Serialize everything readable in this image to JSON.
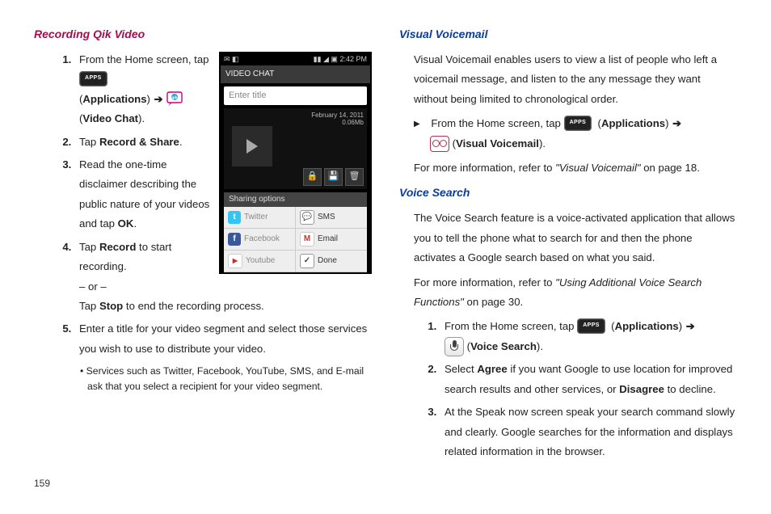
{
  "page_number": "159",
  "left": {
    "heading": "Recording Qik Video",
    "steps": {
      "s1a": "From the Home screen, tap ",
      "s1_apps_paren": "Applications",
      "s1_vc_paren": "Video Chat",
      "s2a": "Tap ",
      "s2b": "Record & Share",
      "s3": "Read the one-time disclaimer describing the public nature of your videos and tap ",
      "s3b": "OK",
      "s4a": "Tap ",
      "s4b": "Record",
      "s4c": " to start recording.",
      "s4or": "– or –",
      "s4d": "Tap ",
      "s4e": "Stop",
      "s4f": " to end the recording process.",
      "s5": "Enter a title for your video segment and select those services you wish to use to distribute your video.",
      "sub": "Services such as Twitter, Facebook, YouTube, SMS, and E-mail ask that you select a recipient for your video segment."
    },
    "phone": {
      "time": "2:42 PM",
      "bar_title": "VIDEO CHAT",
      "input_placeholder": "Enter title",
      "date": "February 14, 2011",
      "size": "0.06Mb",
      "sharing_header": "Sharing options",
      "rows": [
        {
          "l_label": "Twitter",
          "r_label": "SMS"
        },
        {
          "l_label": "Facebook",
          "r_label": "Email"
        },
        {
          "l_label": "Youtube",
          "r_label": "Done"
        }
      ]
    }
  },
  "right": {
    "vv_heading": "Visual Voicemail",
    "vv_p1": "Visual Voicemail enables users to view a list of people who left a voicemail message, and listen to the any message they want without being limited to chronological order.",
    "vv_step_a": "From the Home screen, tap ",
    "vv_apps": "Applications",
    "vv_label": "Visual Voicemail",
    "vv_more_a": "For more information, refer to ",
    "vv_more_ref": "\"Visual Voicemail\"",
    "vv_more_b": " on page 18.",
    "vs_heading": "Voice Search",
    "vs_p1": "The Voice Search feature is a voice-activated application that allows you to tell the phone what to search for and then the phone activates a Google search based on what you said.",
    "vs_more_a": "For more information, refer to ",
    "vs_more_ref": "\"Using Additional Voice Search Functions\"",
    "vs_more_b": " on page 30.",
    "vs_s1a": "From the Home screen, tap ",
    "vs_apps": "Applications",
    "vs_label": "Voice Search",
    "vs_s2a": "Select ",
    "vs_s2b": "Agree",
    "vs_s2c": " if you want Google to use location for improved search results and other services, or ",
    "vs_s2d": "Disagree",
    "vs_s2e": " to decline.",
    "vs_s3": "At the Speak now screen speak your search command slowly and clearly. Google searches for the information and displays related information in the browser."
  }
}
